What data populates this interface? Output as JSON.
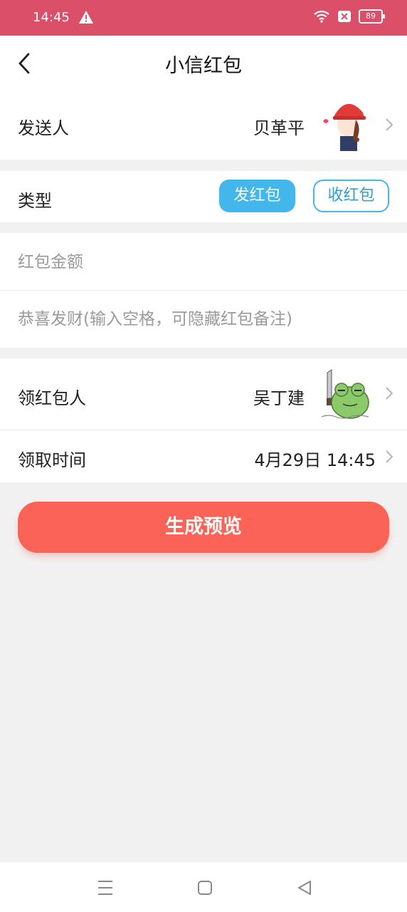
{
  "status_bar": {
    "time": "14:45",
    "battery": "89",
    "bg_color": "#db4f68"
  },
  "header": {
    "title": "小信红包"
  },
  "sender": {
    "label": "发送人",
    "name": "贝革平",
    "avatar_icon": "girl-red-helmet-sticker"
  },
  "type_row": {
    "label": "类型",
    "option_send": "发红包",
    "option_receive": "收红包",
    "selected": "发红包",
    "accent": "#43b6ec"
  },
  "amount": {
    "placeholder": "红包金额",
    "value": ""
  },
  "note": {
    "placeholder": "恭喜发财(输入空格，可隐藏红包备注)",
    "value": ""
  },
  "receiver": {
    "label": "领红包人",
    "name": "吴丁建",
    "avatar_icon": "frog-with-knife-sticker"
  },
  "receive_time": {
    "label": "领取时间",
    "value": "4月29日 14:45"
  },
  "primary_button": {
    "label": "生成预览",
    "color": "#fa6356"
  },
  "nav": {
    "menu_icon": "menu-icon",
    "home_icon": "home-icon",
    "back_icon": "back-triangle-icon"
  }
}
